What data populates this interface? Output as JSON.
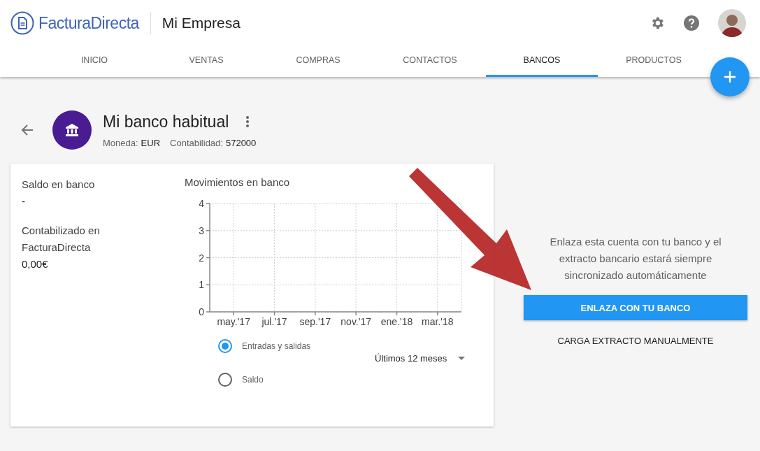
{
  "header": {
    "logo": "FacturaDirecta",
    "company": "Mi Empresa"
  },
  "tabs": [
    {
      "label": "INICIO",
      "selected": false
    },
    {
      "label": "VENTAS",
      "selected": false
    },
    {
      "label": "COMPRAS",
      "selected": false
    },
    {
      "label": "CONTACTOS",
      "selected": false
    },
    {
      "label": "BANCOS",
      "selected": true
    },
    {
      "label": "PRODUCTOS",
      "selected": false
    }
  ],
  "account": {
    "name": "Mi banco habitual",
    "currency_label": "Moneda:",
    "currency": "EUR",
    "accounting_label": "Contabilidad:",
    "accounting": "572000"
  },
  "summary": [
    {
      "label": "Saldo en banco",
      "value": "-"
    },
    {
      "label": "Contabilizado en FacturaDirecta",
      "value": "0,00€"
    }
  ],
  "chart_data": {
    "type": "line",
    "title": "Movimientos en banco",
    "categories": [
      "may.'17",
      "jul.'17",
      "sep.'17",
      "nov.'17",
      "ene.'18",
      "mar.'18"
    ],
    "ylim": [
      0,
      4
    ],
    "yticks": [
      0,
      1,
      2,
      3,
      4
    ],
    "grid": true
  },
  "chart_options": [
    {
      "label": "Entradas y salidas",
      "selected": true
    },
    {
      "label": "Saldo",
      "selected": false
    }
  ],
  "period": "Últimos 12 meses",
  "link_panel": {
    "text": "Enlaza esta cuenta con tu banco y el extracto bancario estará siempre sincronizado automáticamente",
    "primary": "ENLAZA CON TU BANCO",
    "secondary": "CARGA EXTRACTO MANUALMENTE"
  }
}
